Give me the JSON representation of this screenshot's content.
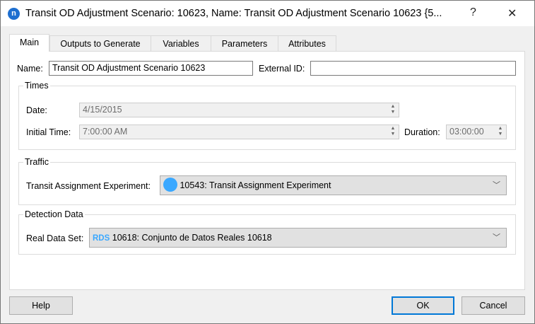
{
  "window": {
    "title": "Transit OD Adjustment Scenario: 10623, Name: Transit OD Adjustment Scenario 10623  {5...",
    "logo": "n",
    "help_glyph": "?",
    "close_glyph": "✕"
  },
  "tabs": [
    {
      "label": "Main",
      "active": true
    },
    {
      "label": "Outputs to Generate"
    },
    {
      "label": "Variables"
    },
    {
      "label": "Parameters"
    },
    {
      "label": "Attributes"
    }
  ],
  "main": {
    "name_label": "Name:",
    "name_value": "Transit OD Adjustment Scenario 10623",
    "external_id_label": "External ID:",
    "external_id_value": "",
    "times": {
      "legend": "Times",
      "date_label": "Date:",
      "date_value": "4/15/2015",
      "initial_time_label": "Initial Time:",
      "initial_time_value": "7:00:00 AM",
      "duration_label": "Duration:",
      "duration_value": "03:00:00"
    },
    "traffic": {
      "legend": "Traffic",
      "experiment_label": "Transit Assignment Experiment:",
      "experiment_value": "10543: Transit Assignment Experiment",
      "icon_color": "#3aa8ff"
    },
    "detection": {
      "legend": "Detection Data",
      "real_data_label": "Real Data Set:",
      "real_data_badge": "RDS",
      "real_data_value": "10618: Conjunto de Datos Reales 10618",
      "badge_color": "#3aa8ff"
    }
  },
  "buttons": {
    "help": "Help",
    "ok": "OK",
    "cancel": "Cancel",
    "ok_border": "#0078d7"
  }
}
